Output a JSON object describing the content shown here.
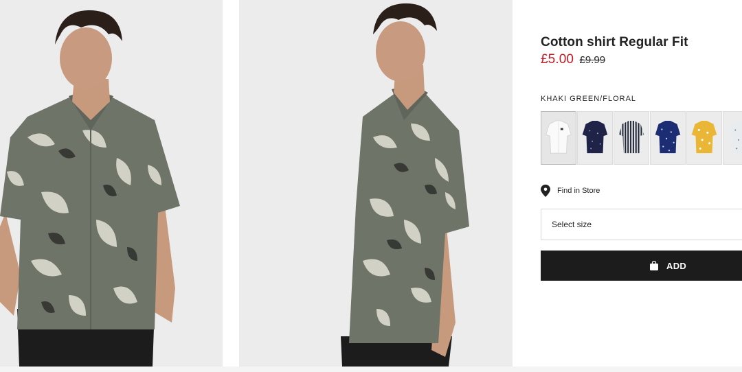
{
  "product": {
    "title": "Cotton shirt Regular Fit",
    "price_now": "£5.00",
    "price_was": "£9.99",
    "colour_name": "KHAKI GREEN/FLORAL"
  },
  "colors": {
    "sale_price": "#c41921",
    "primary_button": "#1c1c1c",
    "shirt_khaki": "#6e7468"
  },
  "images": [
    {
      "name": "model-front-photo"
    },
    {
      "name": "model-side-photo"
    }
  ],
  "swatches": [
    {
      "name": "white",
      "color": "#fafafa",
      "pattern": "plain",
      "selected": true
    },
    {
      "name": "navy-dot",
      "color": "#1f2347",
      "pattern": "dots",
      "selected": false
    },
    {
      "name": "grey-stripe",
      "color": "#9da2a9",
      "pattern": "stripes",
      "selected": false
    },
    {
      "name": "navy-print",
      "color": "#1c2d73",
      "pattern": "dots",
      "selected": false
    },
    {
      "name": "yellow-print",
      "color": "#e9b735",
      "pattern": "dots",
      "selected": false
    },
    {
      "name": "white-print",
      "color": "#e8ecef",
      "pattern": "dots",
      "selected": false
    }
  ],
  "store": {
    "icon": "location-pin-icon",
    "label": "Find in Store"
  },
  "size": {
    "placeholder": "Select size"
  },
  "cart": {
    "icon": "shopping-bag-icon",
    "label": "ADD"
  }
}
